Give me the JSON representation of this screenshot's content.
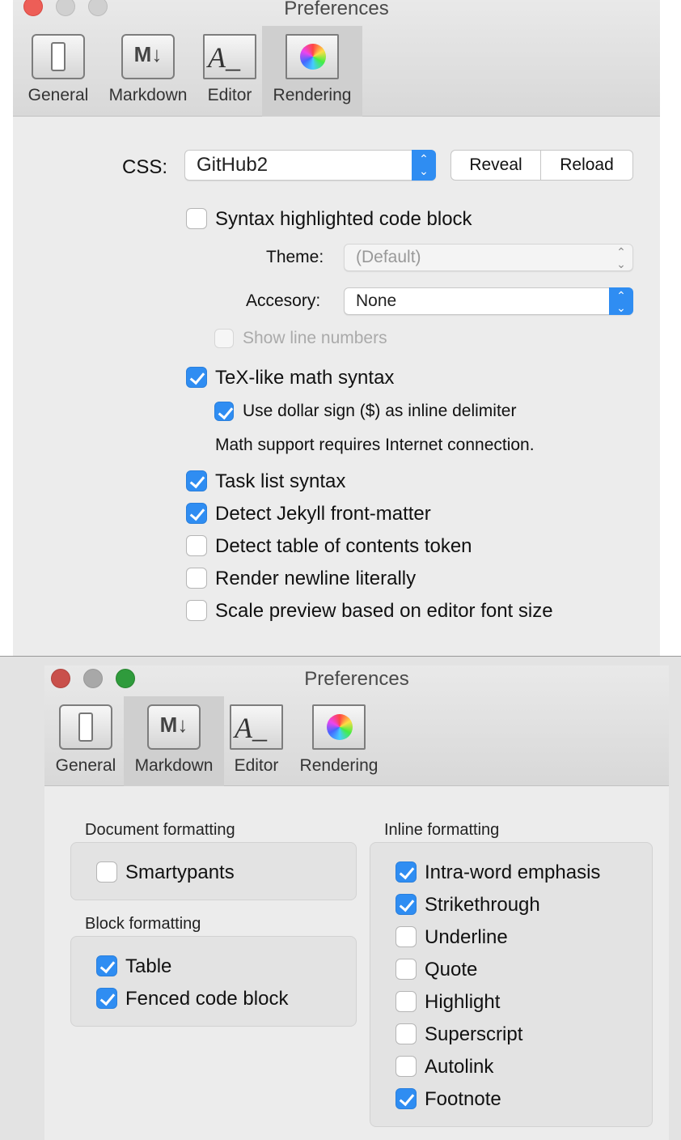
{
  "window1": {
    "title": "Preferences",
    "tabs": [
      "General",
      "Markdown",
      "Editor",
      "Rendering"
    ],
    "selected_tab": "Rendering",
    "css_label": "CSS:",
    "css_value": "GitHub2",
    "reveal_label": "Reveal",
    "reload_label": "Reload",
    "theme_label": "Theme:",
    "theme_value": "(Default)",
    "accessory_label": "Accesory:",
    "accessory_value": "None",
    "math_note": "Math support requires Internet connection.",
    "options": {
      "syntax": {
        "label": "Syntax highlighted code block",
        "checked": false
      },
      "line_numbers": {
        "label": "Show line numbers",
        "checked": false,
        "disabled": true
      },
      "tex": {
        "label": "TeX-like math syntax",
        "checked": true
      },
      "dollar": {
        "label": "Use dollar sign ($) as inline delimiter",
        "checked": true
      },
      "task": {
        "label": "Task list syntax",
        "checked": true
      },
      "jekyll": {
        "label": "Detect Jekyll front-matter",
        "checked": true
      },
      "toc": {
        "label": "Detect table of contents token",
        "checked": false
      },
      "newline": {
        "label": "Render newline literally",
        "checked": false
      },
      "scale": {
        "label": "Scale preview based on editor font size",
        "checked": false
      }
    }
  },
  "window2": {
    "title": "Preferences",
    "tabs": [
      "General",
      "Markdown",
      "Editor",
      "Rendering"
    ],
    "selected_tab": "Markdown",
    "document_heading": "Document formatting",
    "block_heading": "Block formatting",
    "inline_heading": "Inline formatting",
    "document": [
      {
        "label": "Smartypants",
        "checked": false
      }
    ],
    "block": [
      {
        "label": "Table",
        "checked": true
      },
      {
        "label": "Fenced code block",
        "checked": true
      }
    ],
    "inline": [
      {
        "label": "Intra-word emphasis",
        "checked": true
      },
      {
        "label": "Strikethrough",
        "checked": true
      },
      {
        "label": "Underline",
        "checked": false
      },
      {
        "label": "Quote",
        "checked": false
      },
      {
        "label": "Highlight",
        "checked": false
      },
      {
        "label": "Superscript",
        "checked": false
      },
      {
        "label": "Autolink",
        "checked": false
      },
      {
        "label": "Footnote",
        "checked": true
      }
    ]
  },
  "colors": {
    "accent": "#2f8df2",
    "close": "#ed5e57",
    "minimize": "#f5be4f",
    "zoom": "#3fc24f"
  }
}
